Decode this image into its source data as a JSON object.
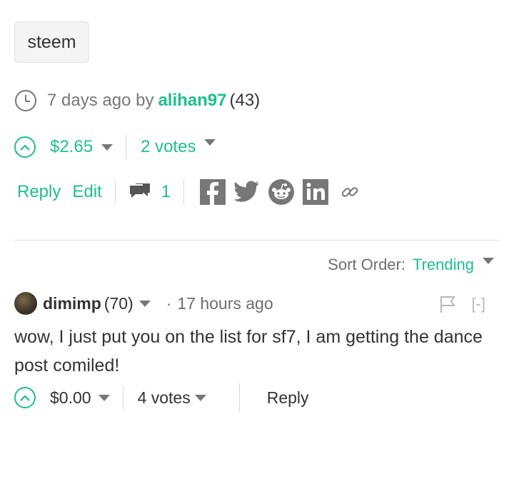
{
  "tag": {
    "label": "steem"
  },
  "post_meta": {
    "time": "7 days ago by",
    "author": "alihan97",
    "reputation": "(43)"
  },
  "post_votes": {
    "payout": "$2.65",
    "votes": "2 votes"
  },
  "post_actions": {
    "reply": "Reply",
    "edit": "Edit",
    "comment_count": "1"
  },
  "share": {
    "icons": [
      "facebook-icon",
      "twitter-icon",
      "reddit-icon",
      "linkedin-icon",
      "link-icon"
    ]
  },
  "sort": {
    "label": "Sort Order:",
    "value": "Trending"
  },
  "comment": {
    "author": "dimimp",
    "reputation": "(70)",
    "separator": "·",
    "time": "17 hours ago",
    "collapse": "[-]",
    "body": "wow, I just put you on the list for sf7, I am getting the dance post comiled!",
    "payout": "$0.00",
    "votes": "4 votes",
    "reply": "Reply"
  },
  "colors": {
    "accent": "#1fbf8f",
    "muted": "#777777",
    "divider": "#e3e3e3"
  }
}
